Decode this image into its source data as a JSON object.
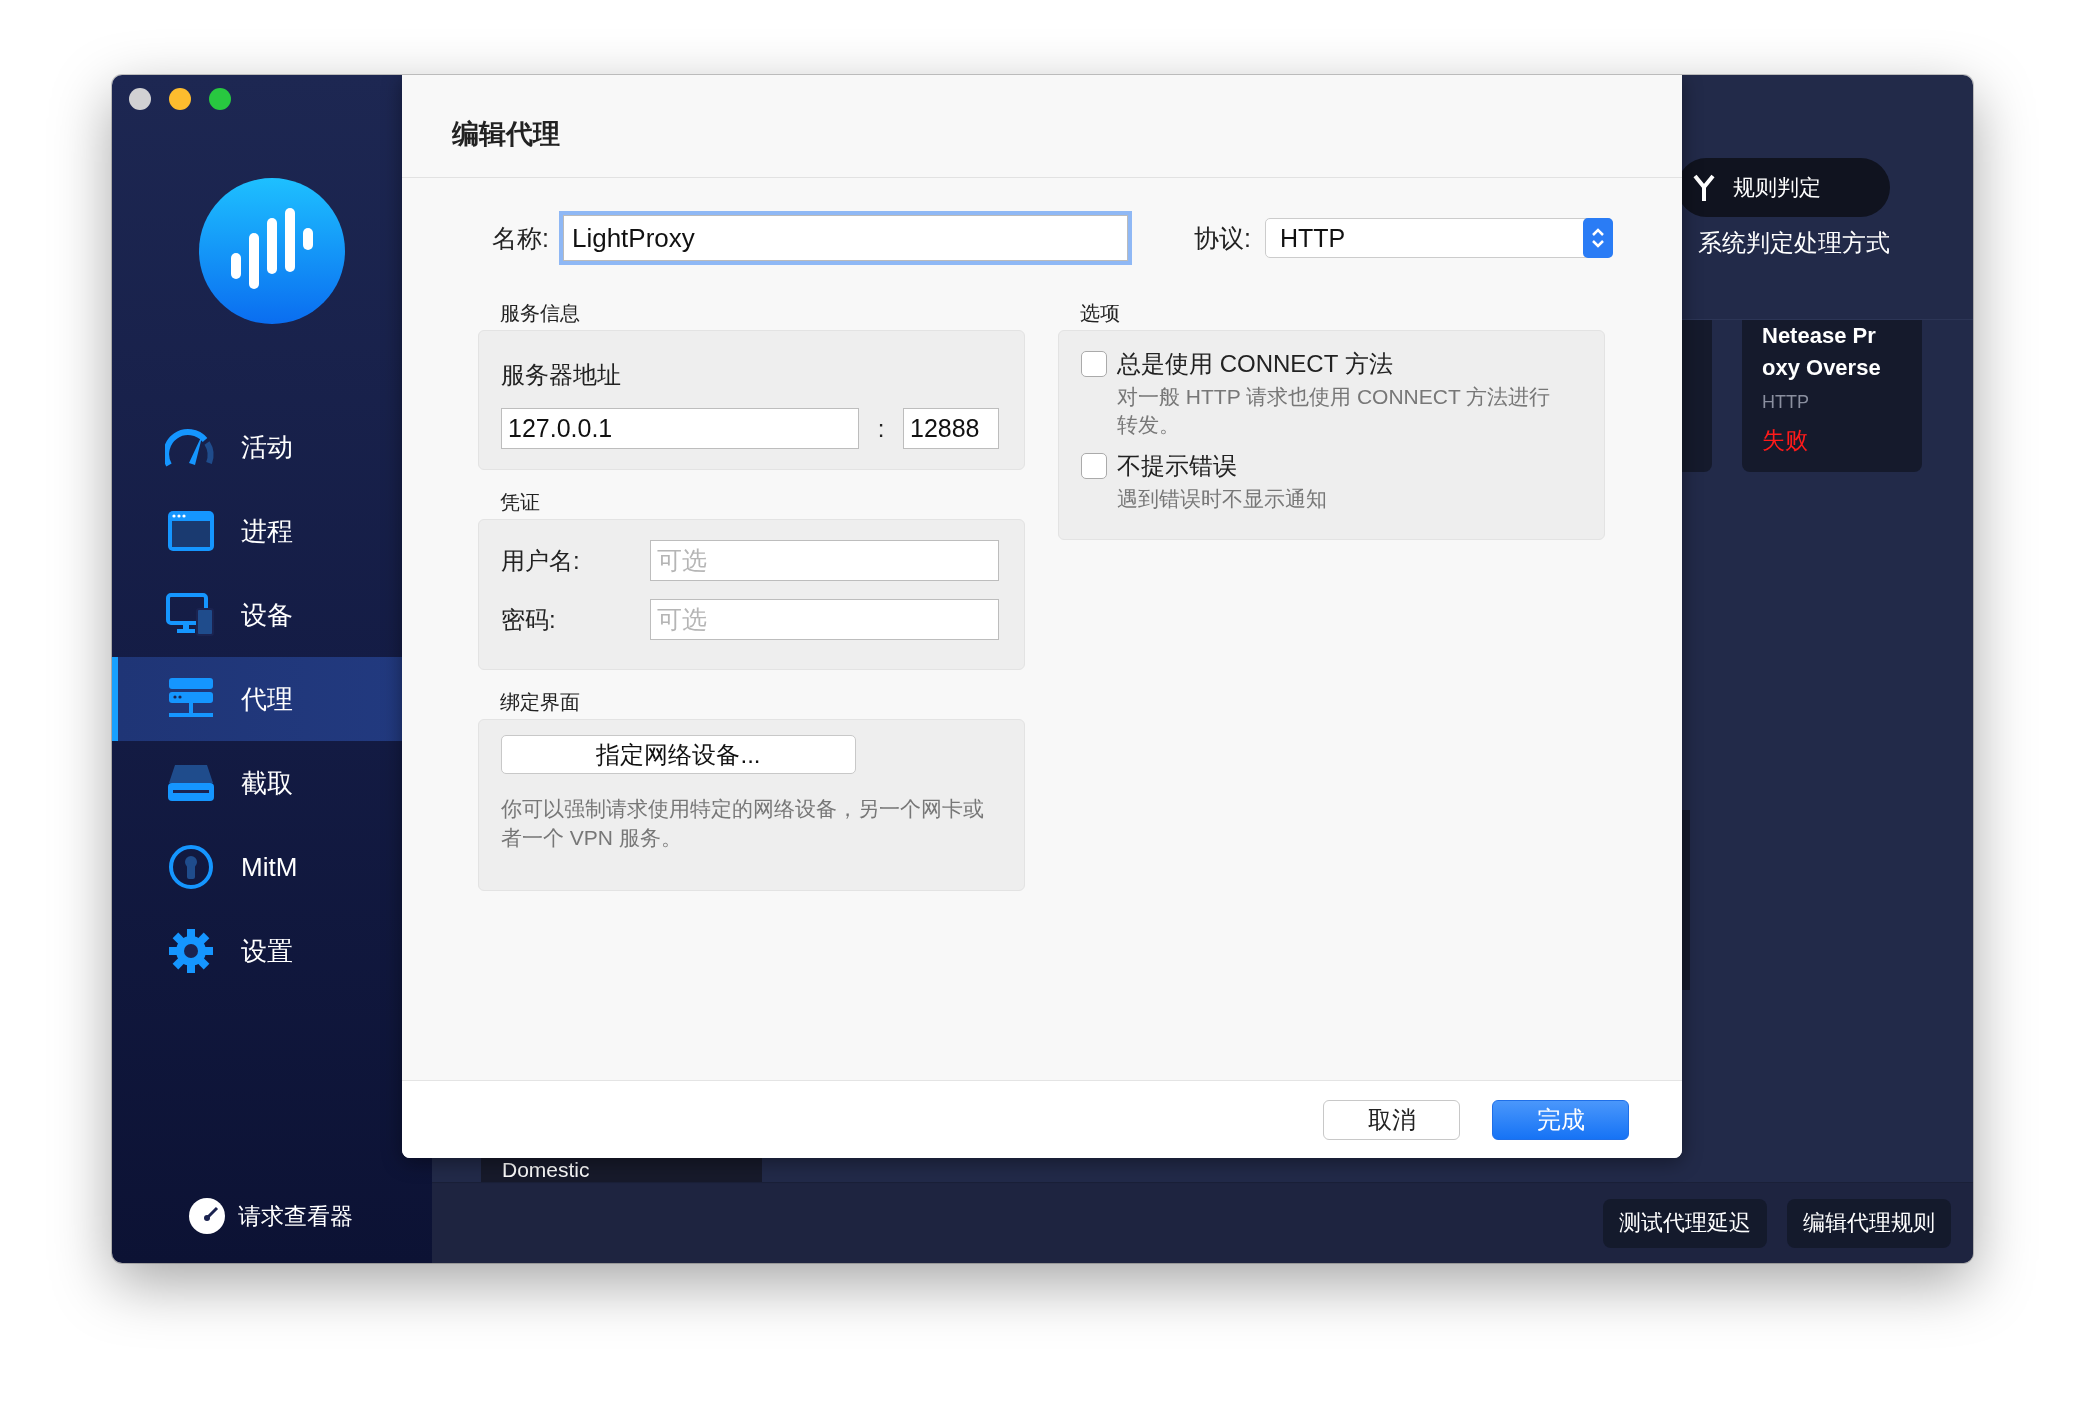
{
  "window": {
    "controls": [
      {
        "color": "#d1d1d3"
      },
      {
        "color": "#fdbc2e"
      },
      {
        "color": "#28c840"
      }
    ]
  },
  "sidebar": {
    "items": [
      {
        "label": "活动",
        "kind": "gauge",
        "selected": false
      },
      {
        "label": "进程",
        "kind": "window",
        "selected": false
      },
      {
        "label": "设备",
        "kind": "devices",
        "selected": false
      },
      {
        "label": "代理",
        "kind": "server",
        "selected": true
      },
      {
        "label": "截取",
        "kind": "drive",
        "selected": false
      },
      {
        "label": "MitM",
        "kind": "keyhole",
        "selected": false
      },
      {
        "label": "设置",
        "kind": "gear",
        "selected": false
      }
    ],
    "footer": {
      "label": "请求查看器"
    }
  },
  "main": {
    "rule_button": {
      "label": "规则判定"
    },
    "rule_caption": "系统判定处理方式",
    "proxy_card": {
      "name": "Netease Proxy Overse",
      "protocol": "HTTP",
      "status": "失败"
    },
    "route_cell": "Domestic",
    "bottom_buttons": [
      "测试代理延迟",
      "编辑代理规则"
    ]
  },
  "dialog": {
    "title": "编辑代理",
    "name": {
      "label": "名称:",
      "value": "LightProxy",
      "focused": true
    },
    "protocol": {
      "label": "协议:",
      "value": "HTTP"
    },
    "server": {
      "section": "服务信息",
      "label": "服务器地址",
      "host": "127.0.0.1",
      "separator": ":",
      "port": "12888"
    },
    "credentials": {
      "section": "凭证",
      "fields": [
        {
          "label": "用户名:",
          "placeholder": "可选"
        },
        {
          "label": "密码:",
          "placeholder": "可选"
        }
      ]
    },
    "binding": {
      "section": "绑定界面",
      "button": "指定网络设备...",
      "note": "你可以强制请求使用特定的网络设备，另一个网卡或者一个 VPN 服务。"
    },
    "options": {
      "section": "选项",
      "items": [
        {
          "label": "总是使用 CONNECT 方法",
          "description": "对一般 HTTP 请求也使用 CONNECT 方法进行转发。",
          "checked": false
        },
        {
          "label": "不提示错误",
          "description": "遇到错误时不显示通知",
          "checked": false
        }
      ]
    },
    "buttons": [
      {
        "label": "取消",
        "kind": "secondary"
      },
      {
        "label": "完成",
        "kind": "primary"
      }
    ]
  }
}
